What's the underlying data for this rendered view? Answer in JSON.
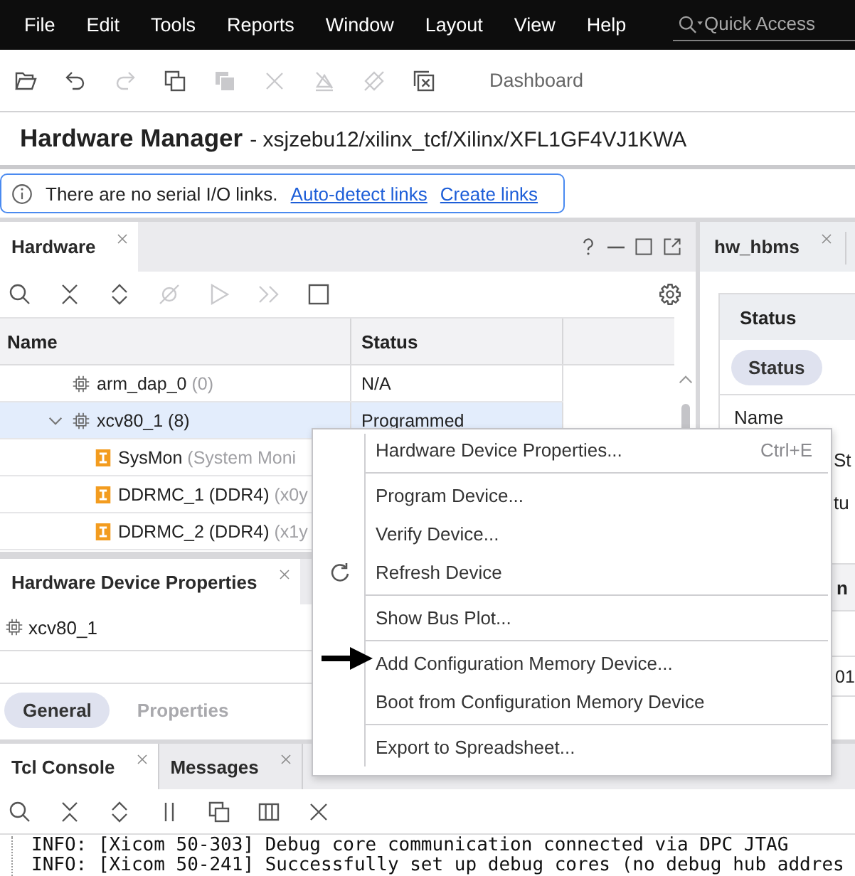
{
  "menu_bar": {
    "items": [
      "File",
      "Edit",
      "Tools",
      "Reports",
      "Window",
      "Layout",
      "View",
      "Help"
    ],
    "quick_access": {
      "placeholder": "Quick Access"
    }
  },
  "toolbar": {
    "tools": [
      {
        "kind": "open",
        "disabled": false
      },
      {
        "kind": "undo",
        "disabled": false
      },
      {
        "kind": "redo",
        "disabled": true
      },
      {
        "kind": "copy",
        "disabled": false
      },
      {
        "kind": "stack",
        "disabled": true
      },
      {
        "kind": "delete",
        "disabled": true
      },
      {
        "kind": "clear",
        "disabled": true
      },
      {
        "kind": "unlink",
        "disabled": true
      },
      {
        "kind": "close",
        "disabled": false
      }
    ],
    "dashboard": "Dashboard"
  },
  "title": {
    "name": "Hardware Manager",
    "path": "- xsjzebu12/xilinx_tcf/Xilinx/XFL1GF4VJ1KWA"
  },
  "info_banner": {
    "message": "There are no serial I/O links.",
    "links": [
      "Auto-detect links",
      "Create links"
    ]
  },
  "hardware_panel": {
    "tabs": [
      {
        "label": "Hardware",
        "selected": true
      }
    ],
    "tools": [
      {
        "kind": "search",
        "disabled": false
      },
      {
        "kind": "collapse",
        "disabled": false
      },
      {
        "kind": "expand",
        "disabled": false
      },
      {
        "kind": "slash",
        "disabled": true
      },
      {
        "kind": "play",
        "disabled": true
      },
      {
        "kind": "forward",
        "disabled": true
      },
      {
        "kind": "stop",
        "disabled": false
      }
    ],
    "columns": [
      "Name",
      "Status"
    ],
    "tree": [
      {
        "kind": "chip",
        "name": "arm_dap_0",
        "detail": "(0)",
        "status": "N/A",
        "selected": false
      },
      {
        "kind": "chip",
        "name": "xcv80_1 (8)",
        "status": "Programmed",
        "selected": true,
        "expanded": true,
        "children": [
          {
            "kind": "core",
            "name": "SysMon",
            "detail": "(System Moni",
            "selected": false
          },
          {
            "kind": "core",
            "name": "DDRMC_1 (DDR4)",
            "detail": "(x0y",
            "selected": false
          },
          {
            "kind": "core",
            "name": "DDRMC_2 (DDR4)",
            "detail": "(x1y",
            "selected": false
          }
        ]
      }
    ]
  },
  "properties_panel": {
    "tabs": [
      {
        "label": "Hardware Device Properties",
        "selected": true
      }
    ],
    "object": {
      "kind": "chip",
      "name": "xcv80_1"
    },
    "subtabs": [
      {
        "label": "General",
        "selected": true
      },
      {
        "label": "Properties",
        "selected": false
      }
    ]
  },
  "side_panel": {
    "tabs": [
      {
        "label": "hw_hbms"
      }
    ],
    "section": "Status",
    "subtabs": [
      {
        "label": "Status",
        "selected": true
      }
    ],
    "fields": [
      {
        "column_1": "Name"
      },
      {
        "column_2": "St"
      },
      {
        "column_2": "tu"
      }
    ],
    "table": {
      "column_2": "n",
      "rows": [
        {
          "column_2": "01"
        }
      ]
    }
  },
  "tcl_console": {
    "tabs": [
      {
        "label": "Tcl Console",
        "selected": true
      },
      {
        "label": "Messages",
        "selected": false
      }
    ],
    "tools": [
      {
        "kind": "search",
        "disabled": false
      },
      {
        "kind": "collapse",
        "disabled": false
      },
      {
        "kind": "expand",
        "disabled": false
      },
      {
        "kind": "pause",
        "disabled": false
      },
      {
        "kind": "copy",
        "disabled": false
      },
      {
        "kind": "columns",
        "disabled": false
      },
      {
        "kind": "delete",
        "disabled": false
      }
    ],
    "lines": [
      "INFO: [Xicom 50-303] Debug core communication connected via DPC JTAG",
      "INFO: [Xicom 50-241] Successfully set up debug cores (no debug hub addres"
    ]
  },
  "context_menu": {
    "items": [
      {
        "kind": "item",
        "label": "Hardware Device Properties...",
        "shortcut": "Ctrl+E",
        "icon": false,
        "annotated": false
      },
      {
        "kind": "separator"
      },
      {
        "kind": "item",
        "label": "Program Device...",
        "icon": false,
        "annotated": false
      },
      {
        "kind": "item",
        "label": "Verify Device...",
        "icon": false,
        "annotated": false
      },
      {
        "kind": "item",
        "label": "Refresh Device",
        "icon": true,
        "annotated": false
      },
      {
        "kind": "separator"
      },
      {
        "kind": "item",
        "label": "Show Bus Plot...",
        "icon": false,
        "annotated": false
      },
      {
        "kind": "separator"
      },
      {
        "kind": "item",
        "label": "Add Configuration Memory Device...",
        "icon": false,
        "annotated": true
      },
      {
        "kind": "item",
        "label": "Boot from Configuration Memory Device",
        "icon": false,
        "annotated": false
      },
      {
        "kind": "separator"
      },
      {
        "kind": "item",
        "label": "Export to Spreadsheet...",
        "icon": false,
        "annotated": false
      }
    ]
  }
}
